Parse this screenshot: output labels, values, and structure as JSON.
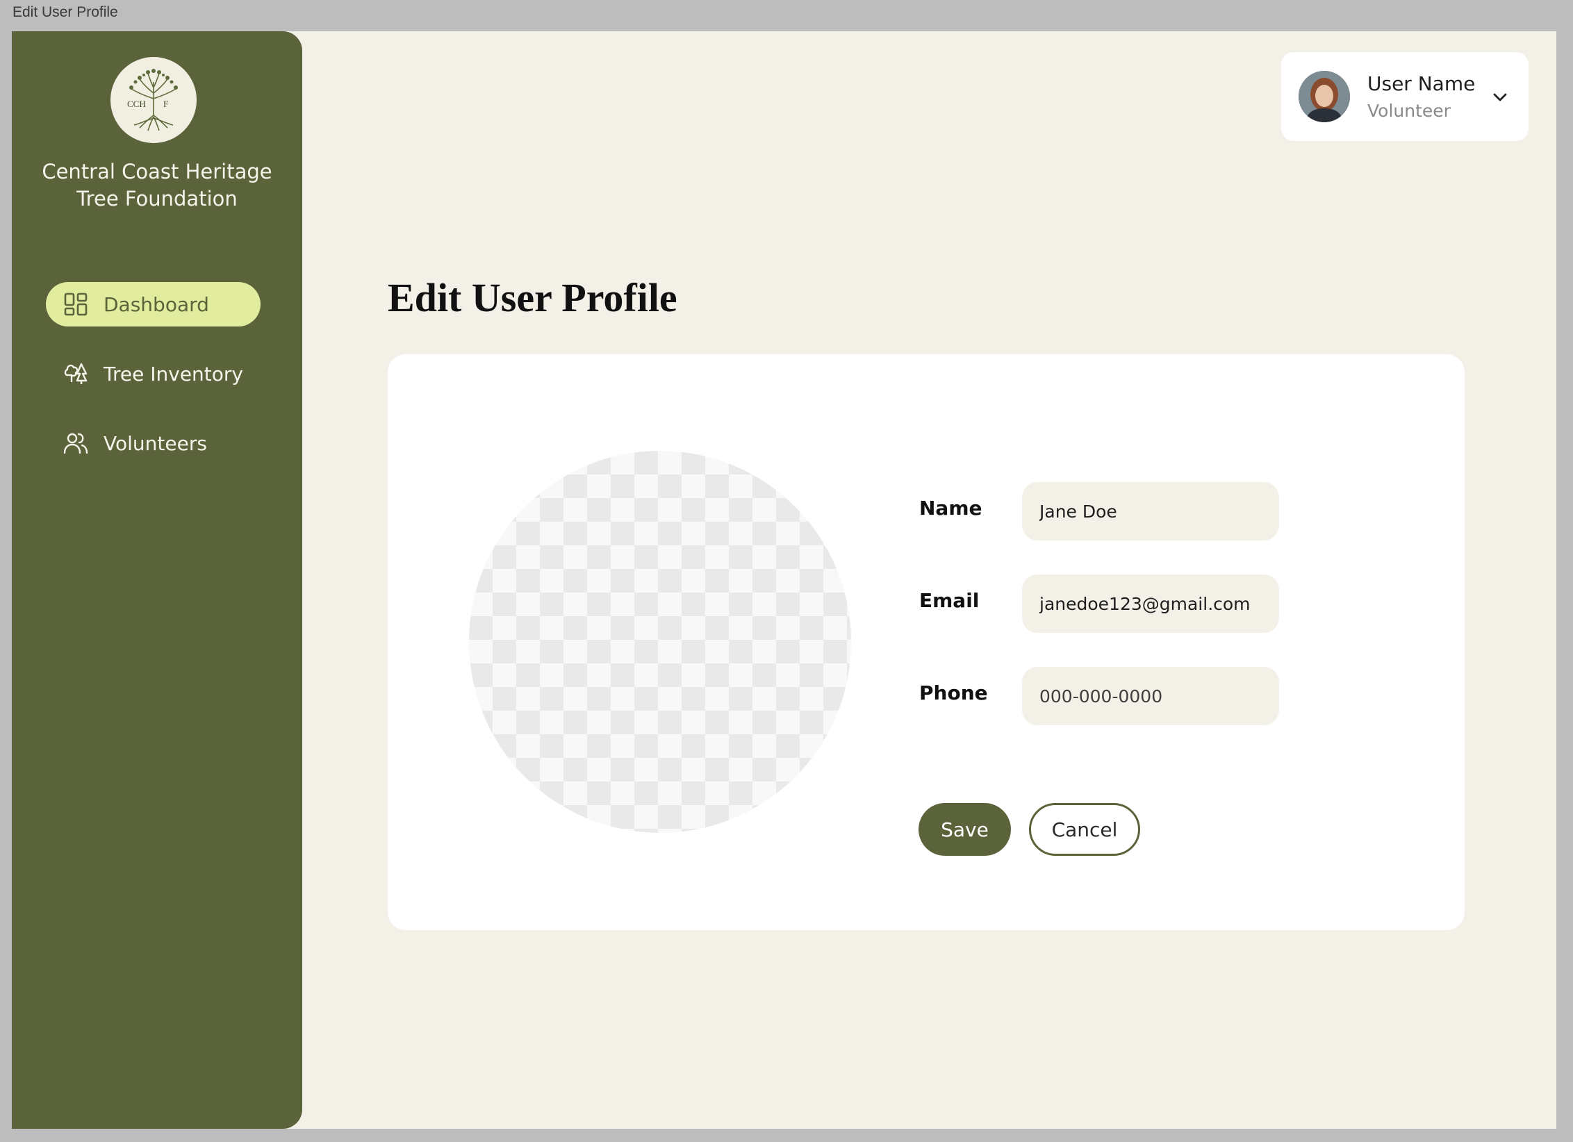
{
  "window": {
    "title": "Edit User Profile"
  },
  "sidebar": {
    "logo": {
      "text_left": "CCH",
      "text_right": "F",
      "icon": "tree-icon"
    },
    "org_name_line1": "Central Coast Heritage",
    "org_name_line2": "Tree Foundation",
    "items": [
      {
        "label": "Dashboard",
        "icon": "dashboard-grid-icon",
        "active": true
      },
      {
        "label": "Tree Inventory",
        "icon": "trees-icon",
        "active": false
      },
      {
        "label": "Volunteers",
        "icon": "users-icon",
        "active": false
      }
    ]
  },
  "user": {
    "name": "User Name",
    "role": "Volunteer"
  },
  "main": {
    "title": "Edit User Profile",
    "form": {
      "name_label": "Name",
      "name_value": "Jane Doe",
      "email_label": "Email",
      "email_value": "janedoe123@gmail.com",
      "phone_label": "Phone",
      "phone_placeholder": "000-000-0000"
    },
    "save_label": "Save",
    "cancel_label": "Cancel"
  },
  "colors": {
    "sidebar_bg": "#5b633a",
    "active_nav_bg": "#e2ec9f",
    "page_bg": "#f3f0e8",
    "input_bg": "#f3f0e8"
  }
}
